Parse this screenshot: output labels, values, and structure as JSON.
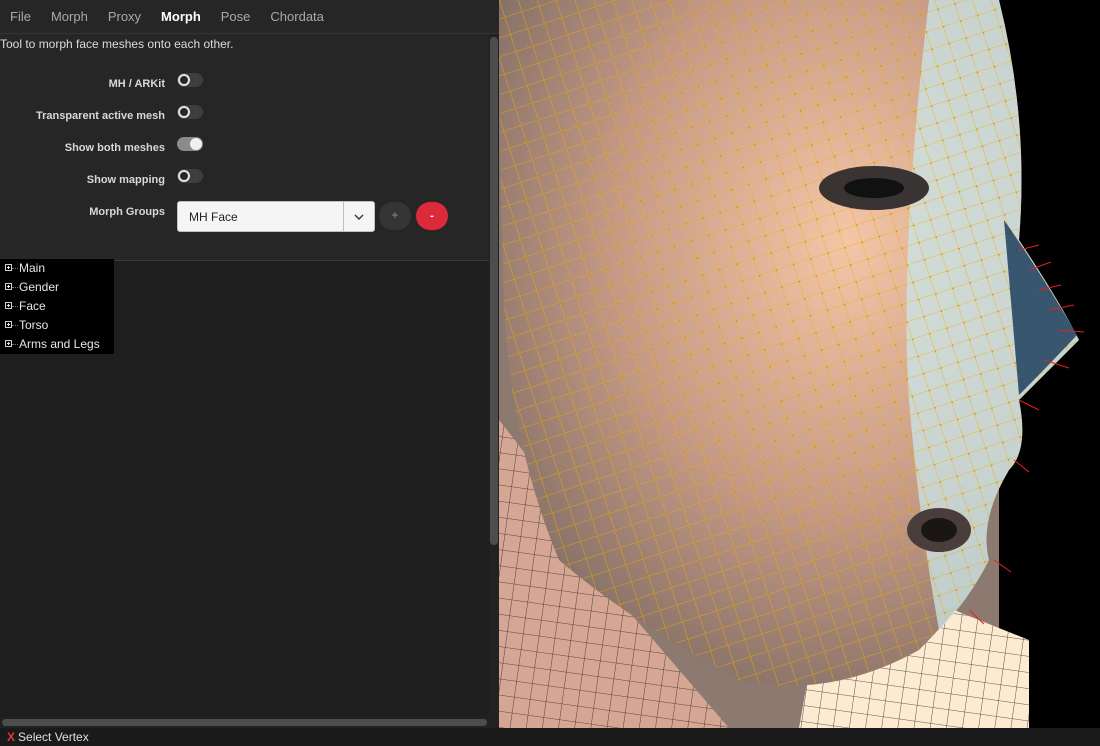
{
  "menu": {
    "items": [
      "File",
      "Morph",
      "Proxy",
      "Morph",
      "Pose",
      "Chordata"
    ],
    "active_index": 3
  },
  "settings": {
    "description": "Tool to morph face meshes onto each other.",
    "toggles": [
      {
        "label": "MH / ARKit",
        "on": false
      },
      {
        "label": "Transparent active mesh",
        "on": false
      },
      {
        "label": "Show both meshes",
        "on": true
      },
      {
        "label": "Show mapping",
        "on": false
      }
    ],
    "morph_groups": {
      "label": "Morph Groups",
      "selected": "MH Face",
      "add_label": "+",
      "remove_label": "-"
    }
  },
  "tree": {
    "items": [
      "Main",
      "Gender",
      "Face",
      "Torso",
      "Arms and Legs"
    ]
  },
  "status": {
    "icon": "x-mark",
    "text": "Select Vertex"
  },
  "viewport": {
    "colors": {
      "mesh_line": "#f2b100",
      "vertex": "#e28a00",
      "normal": "#e52020",
      "background": "#000000"
    }
  },
  "colors": {
    "accent_remove": "#dc2a3a",
    "panel_bg": "#262626"
  }
}
